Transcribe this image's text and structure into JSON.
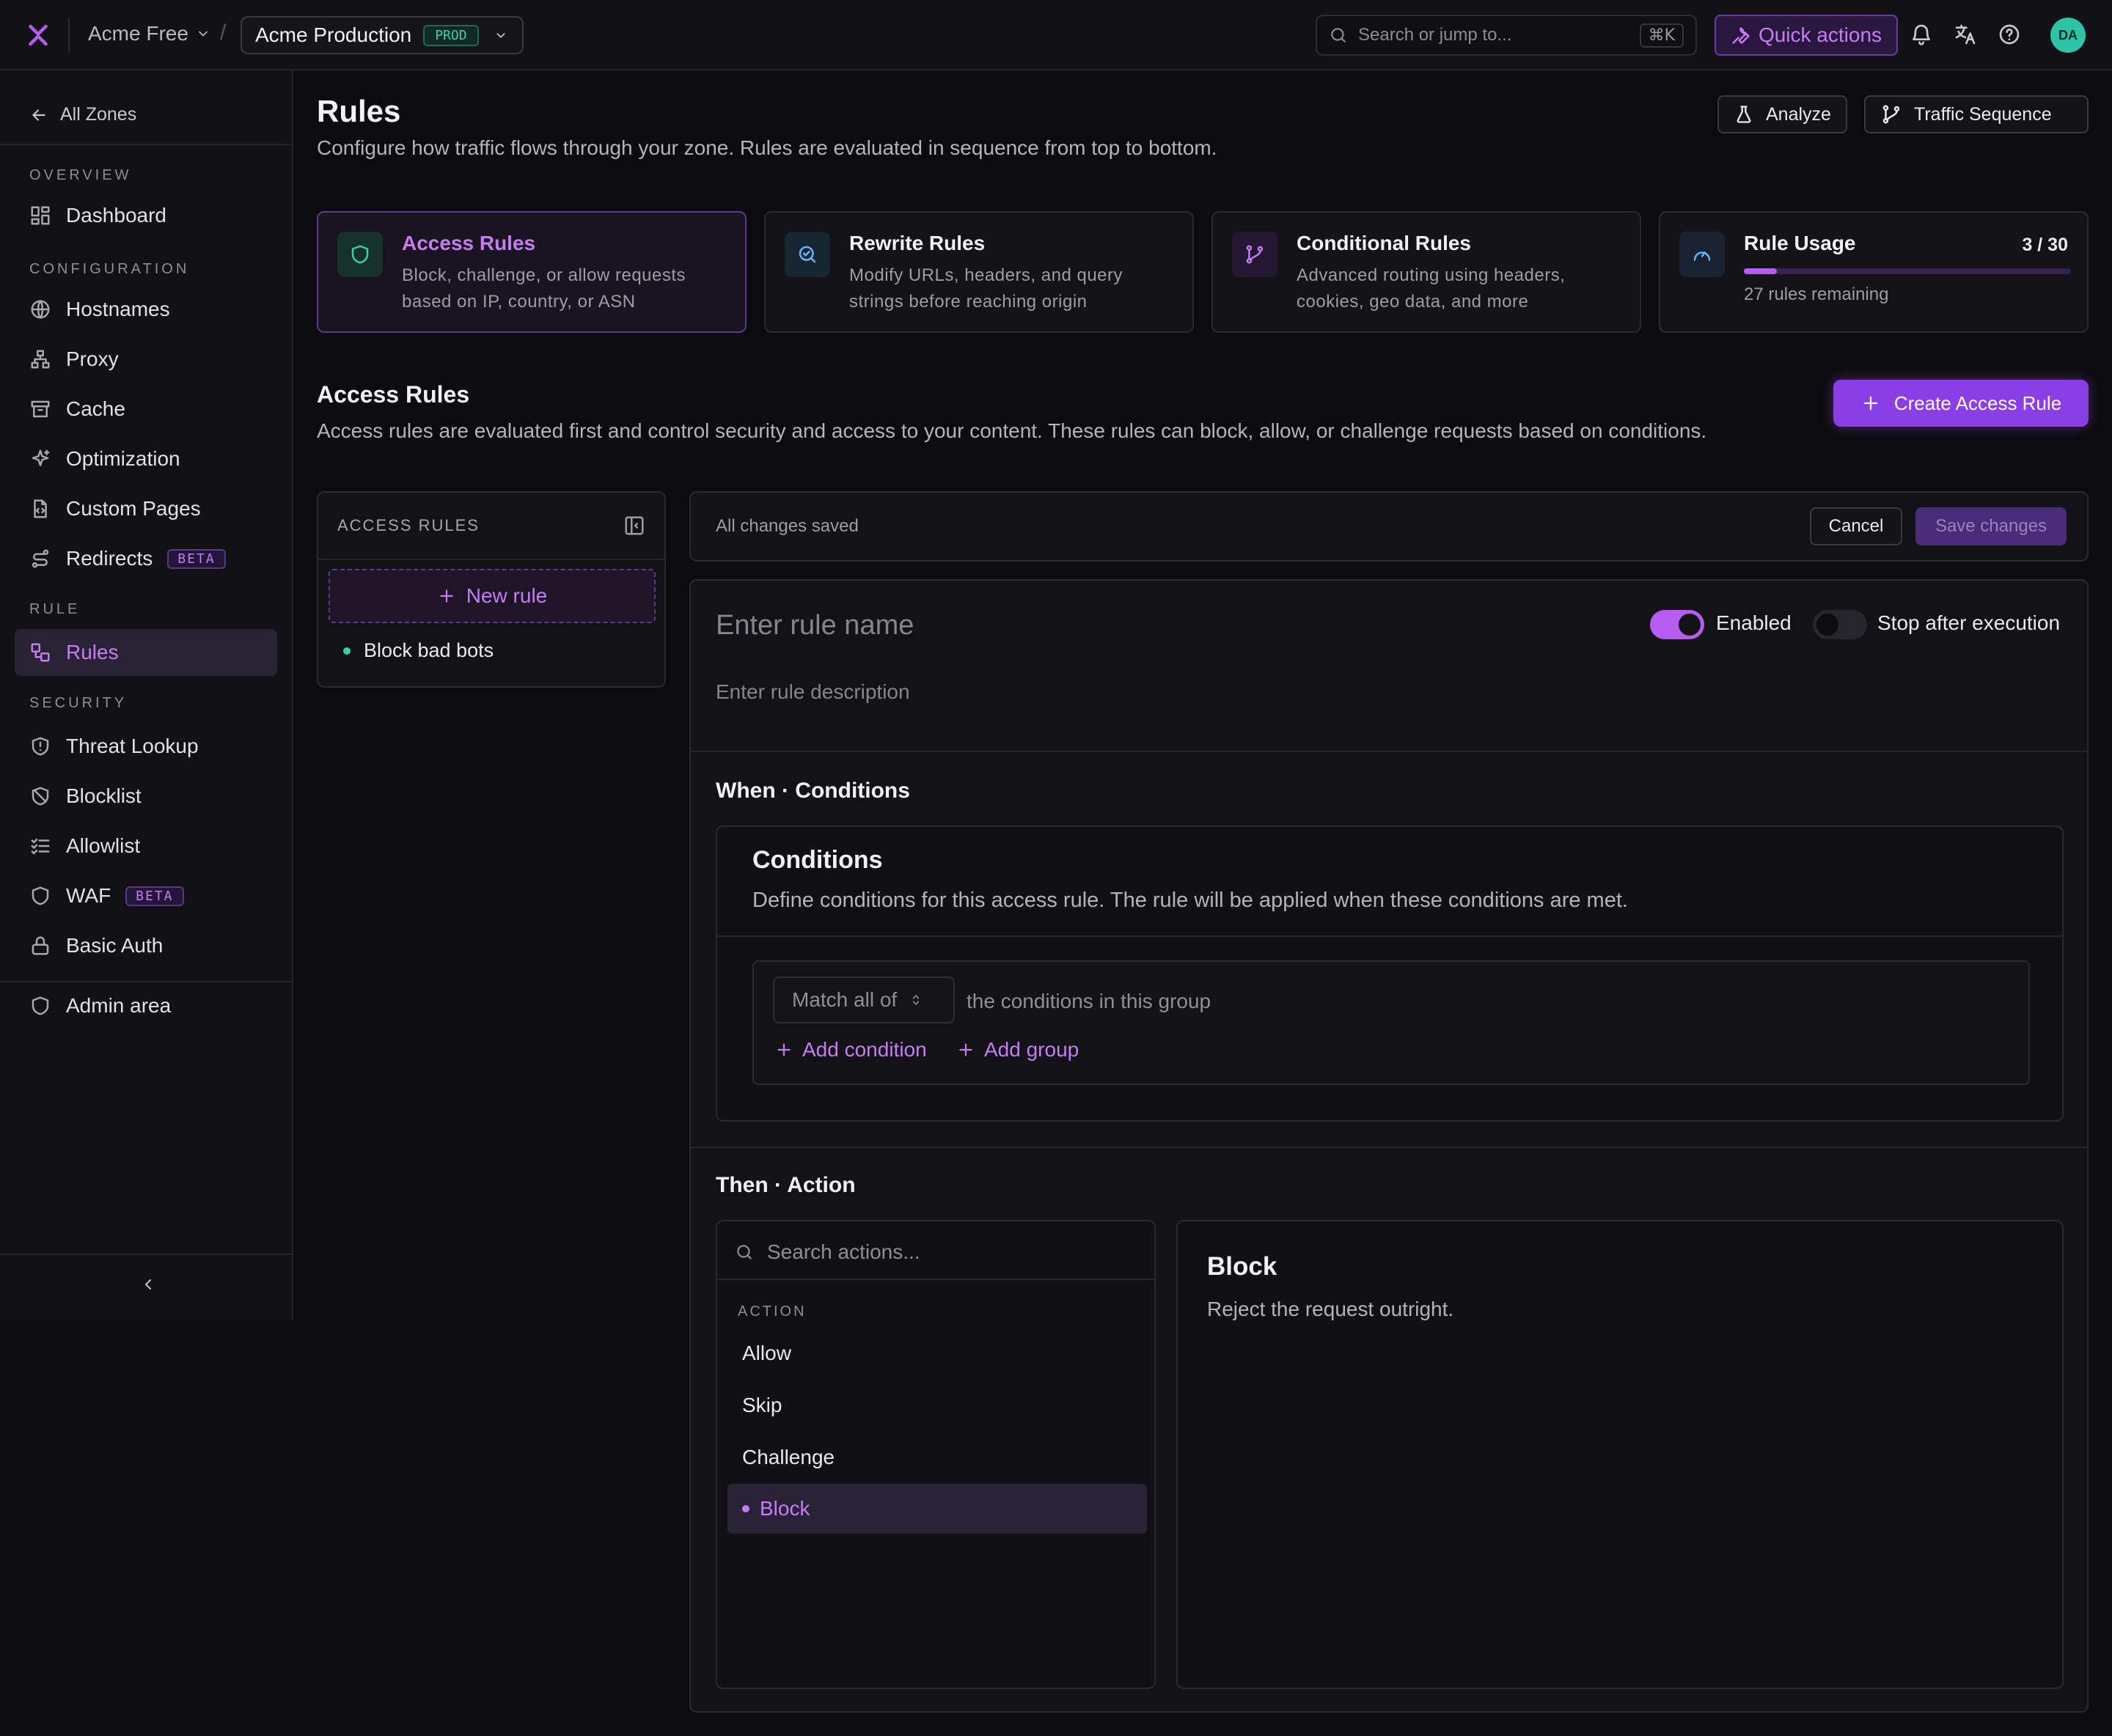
{
  "topbar": {
    "org_name": "Acme Free",
    "separator": "/",
    "environment": "Acme Production",
    "env_badge": "PROD",
    "search_placeholder": "Search or jump to...",
    "search_shortcut": "⌘K",
    "quick_actions": "Quick actions",
    "avatar_initials": "DA"
  },
  "sidebar": {
    "back_label": "All Zones",
    "sections": {
      "overview": "OVERVIEW",
      "configuration": "CONFIGURATION",
      "rule": "RULE",
      "security": "SECURITY"
    },
    "items": {
      "dashboard": "Dashboard",
      "hostnames": "Hostnames",
      "proxy": "Proxy",
      "cache": "Cache",
      "optimization": "Optimization",
      "custom_pages": "Custom Pages",
      "redirects": "Redirects",
      "rules": "Rules",
      "threat_lookup": "Threat Lookup",
      "blocklist": "Blocklist",
      "allowlist": "Allowlist",
      "waf": "WAF",
      "basic_auth": "Basic Auth",
      "admin_area": "Admin area"
    },
    "beta_label": "BETA",
    "active_item": "rules"
  },
  "header": {
    "title": "Rules",
    "subtitle": "Configure how traffic flows through your zone. Rules are evaluated in sequence from top to bottom.",
    "analyze_label": "Analyze",
    "traffic_sequence_label": "Traffic Sequence"
  },
  "cards": {
    "access": {
      "title": "Access Rules",
      "desc": "Block, challenge, or allow requests based on IP, country, or ASN"
    },
    "rewrite": {
      "title": "Rewrite Rules",
      "desc": "Modify URLs, headers, and query strings before reaching origin"
    },
    "conditional": {
      "title": "Conditional Rules",
      "desc": "Advanced routing using headers, cookies, geo data, and more"
    },
    "usage": {
      "title": "Rule Usage",
      "count_text": "3 / 30",
      "used": 3,
      "limit": 30,
      "remaining_text": "27 rules remaining"
    }
  },
  "section": {
    "title": "Access Rules",
    "subtitle": "Access rules are evaluated first and control security and access to your content. These rules can block, allow, or challenge requests based on conditions.",
    "create_label": "Create Access Rule"
  },
  "rule_list": {
    "header": "ACCESS RULES",
    "new_rule_label": "New rule",
    "rules": [
      "Block bad bots"
    ]
  },
  "editor": {
    "status_text": "All changes saved",
    "cancel_label": "Cancel",
    "save_label": "Save changes",
    "name_placeholder": "Enter rule name",
    "description_placeholder": "Enter rule description",
    "enabled_label": "Enabled",
    "enabled": true,
    "stop_label": "Stop after execution",
    "stop_after": false,
    "when_heading": "When · Conditions",
    "conditions_title": "Conditions",
    "conditions_desc": "Define conditions for this access rule. The rule will be applied when these conditions are met.",
    "match_value": "Match all of",
    "match_rest": "the conditions in this group",
    "add_condition": "Add condition",
    "add_group": "Add group",
    "then_heading": "Then · Action",
    "action_search_placeholder": "Search actions...",
    "action_group_label": "ACTION",
    "actions": [
      "Allow",
      "Skip",
      "Challenge",
      "Block"
    ],
    "selected_action": "Block",
    "detail_title": "Block",
    "detail_desc": "Reject the request outright."
  },
  "colors": {
    "accent": "#b65cf2",
    "accent_text": "#c77cf7",
    "success": "#34d3a6",
    "background": "#0c0c0e",
    "panel": "#131317"
  }
}
